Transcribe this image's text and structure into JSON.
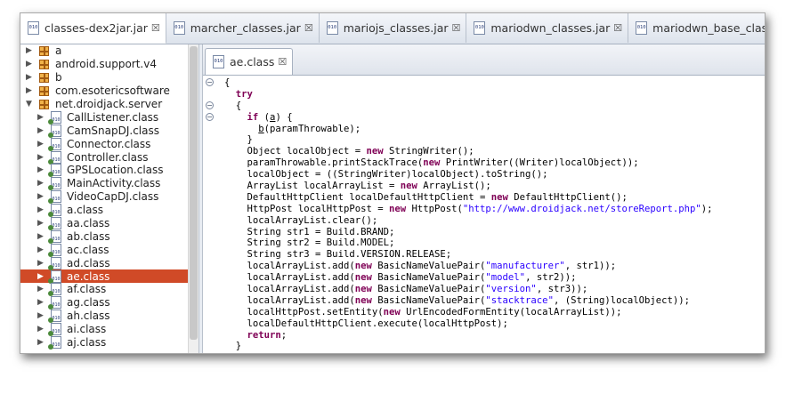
{
  "top_tabs": [
    {
      "label": "classes-dex2jar.jar",
      "active": true
    },
    {
      "label": "marcher_classes.jar",
      "active": false
    },
    {
      "label": "mariojs_classes.jar",
      "active": false
    },
    {
      "label": "mariodwn_classes.jar",
      "active": false
    },
    {
      "label": "mariodwn_base_classes.jar",
      "active": false
    }
  ],
  "tab_close_glyph": "☒",
  "class_icon_text": "010",
  "tree": {
    "packages": [
      "a",
      "android.support.v4",
      "b",
      "com.esotericsoftware",
      "net.droidjack.server"
    ],
    "classes": [
      "CallListener.class",
      "CamSnapDJ.class",
      "Connector.class",
      "Controller.class",
      "GPSLocation.class",
      "MainActivity.class",
      "VideoCapDJ.class",
      "a.class",
      "aa.class",
      "ab.class",
      "ac.class",
      "ad.class",
      "ae.class",
      "af.class",
      "ag.class",
      "ah.class",
      "ai.class",
      "aj.class"
    ],
    "selected": "ae.class"
  },
  "editor": {
    "tab_label": "ae.class",
    "code": [
      {
        "indent": "",
        "parts": [
          {
            "t": "{",
            "k": "p"
          }
        ]
      },
      {
        "indent": "  ",
        "parts": [
          {
            "t": "try",
            "k": "kw"
          }
        ]
      },
      {
        "indent": "  ",
        "parts": [
          {
            "t": "{",
            "k": "p"
          }
        ]
      },
      {
        "indent": "    ",
        "parts": [
          {
            "t": "if",
            "k": "kw"
          },
          {
            "t": " (",
            "k": "p"
          },
          {
            "t": "a",
            "k": "ul"
          },
          {
            "t": ") {",
            "k": "p"
          }
        ]
      },
      {
        "indent": "      ",
        "parts": [
          {
            "t": "b",
            "k": "ul"
          },
          {
            "t": "(paramThrowable);",
            "k": "p"
          }
        ]
      },
      {
        "indent": "    ",
        "parts": [
          {
            "t": "}",
            "k": "p"
          }
        ]
      },
      {
        "indent": "    ",
        "parts": [
          {
            "t": "Object localObject = ",
            "k": "p"
          },
          {
            "t": "new",
            "k": "kw"
          },
          {
            "t": " StringWriter();",
            "k": "p"
          }
        ]
      },
      {
        "indent": "    ",
        "parts": [
          {
            "t": "paramThrowable.printStackTrace(",
            "k": "p"
          },
          {
            "t": "new",
            "k": "kw"
          },
          {
            "t": " PrintWriter((Writer)localObject));",
            "k": "p"
          }
        ]
      },
      {
        "indent": "    ",
        "parts": [
          {
            "t": "localObject = ((StringWriter)localObject).toString();",
            "k": "p"
          }
        ]
      },
      {
        "indent": "    ",
        "parts": [
          {
            "t": "ArrayList localArrayList = ",
            "k": "p"
          },
          {
            "t": "new",
            "k": "kw"
          },
          {
            "t": " ArrayList();",
            "k": "p"
          }
        ]
      },
      {
        "indent": "    ",
        "parts": [
          {
            "t": "DefaultHttpClient localDefaultHttpClient = ",
            "k": "p"
          },
          {
            "t": "new",
            "k": "kw"
          },
          {
            "t": " DefaultHttpClient();",
            "k": "p"
          }
        ]
      },
      {
        "indent": "    ",
        "parts": [
          {
            "t": "HttpPost localHttpPost = ",
            "k": "p"
          },
          {
            "t": "new",
            "k": "kw"
          },
          {
            "t": " HttpPost(",
            "k": "p"
          },
          {
            "t": "\"http://www.droidjack.net/storeReport.php\"",
            "k": "str"
          },
          {
            "t": ");",
            "k": "p"
          }
        ]
      },
      {
        "indent": "    ",
        "parts": [
          {
            "t": "localArrayList.clear();",
            "k": "p"
          }
        ]
      },
      {
        "indent": "    ",
        "parts": [
          {
            "t": "String str1 = Build.BRAND;",
            "k": "p"
          }
        ]
      },
      {
        "indent": "    ",
        "parts": [
          {
            "t": "String str2 = Build.MODEL;",
            "k": "p"
          }
        ]
      },
      {
        "indent": "    ",
        "parts": [
          {
            "t": "String str3 = Build.VERSION.RELEASE;",
            "k": "p"
          }
        ]
      },
      {
        "indent": "    ",
        "parts": [
          {
            "t": "localArrayList.add(",
            "k": "p"
          },
          {
            "t": "new",
            "k": "kw"
          },
          {
            "t": " BasicNameValuePair(",
            "k": "p"
          },
          {
            "t": "\"manufacturer\"",
            "k": "str"
          },
          {
            "t": ", str1));",
            "k": "p"
          }
        ]
      },
      {
        "indent": "    ",
        "parts": [
          {
            "t": "localArrayList.add(",
            "k": "p"
          },
          {
            "t": "new",
            "k": "kw"
          },
          {
            "t": " BasicNameValuePair(",
            "k": "p"
          },
          {
            "t": "\"model\"",
            "k": "str"
          },
          {
            "t": ", str2));",
            "k": "p"
          }
        ]
      },
      {
        "indent": "    ",
        "parts": [
          {
            "t": "localArrayList.add(",
            "k": "p"
          },
          {
            "t": "new",
            "k": "kw"
          },
          {
            "t": " BasicNameValuePair(",
            "k": "p"
          },
          {
            "t": "\"version\"",
            "k": "str"
          },
          {
            "t": ", str3));",
            "k": "p"
          }
        ]
      },
      {
        "indent": "    ",
        "parts": [
          {
            "t": "localArrayList.add(",
            "k": "p"
          },
          {
            "t": "new",
            "k": "kw"
          },
          {
            "t": " BasicNameValuePair(",
            "k": "p"
          },
          {
            "t": "\"stacktrace\"",
            "k": "str"
          },
          {
            "t": ", (String)localObject));",
            "k": "p"
          }
        ]
      },
      {
        "indent": "    ",
        "parts": [
          {
            "t": "localHttpPost.setEntity(",
            "k": "p"
          },
          {
            "t": "new",
            "k": "kw"
          },
          {
            "t": " UrlEncodedFormEntity(localArrayList));",
            "k": "p"
          }
        ]
      },
      {
        "indent": "    ",
        "parts": [
          {
            "t": "localDefaultHttpClient.execute(localHttpPost);",
            "k": "p"
          }
        ]
      },
      {
        "indent": "    ",
        "parts": [
          {
            "t": "return",
            "k": "kw"
          },
          {
            "t": ";",
            "k": "p"
          }
        ]
      },
      {
        "indent": "  ",
        "parts": [
          {
            "t": "}",
            "k": "p"
          }
        ]
      }
    ]
  },
  "colors": {
    "keyword": "#7f0055",
    "string": "#2a00ff",
    "selection": "#d04a27"
  }
}
